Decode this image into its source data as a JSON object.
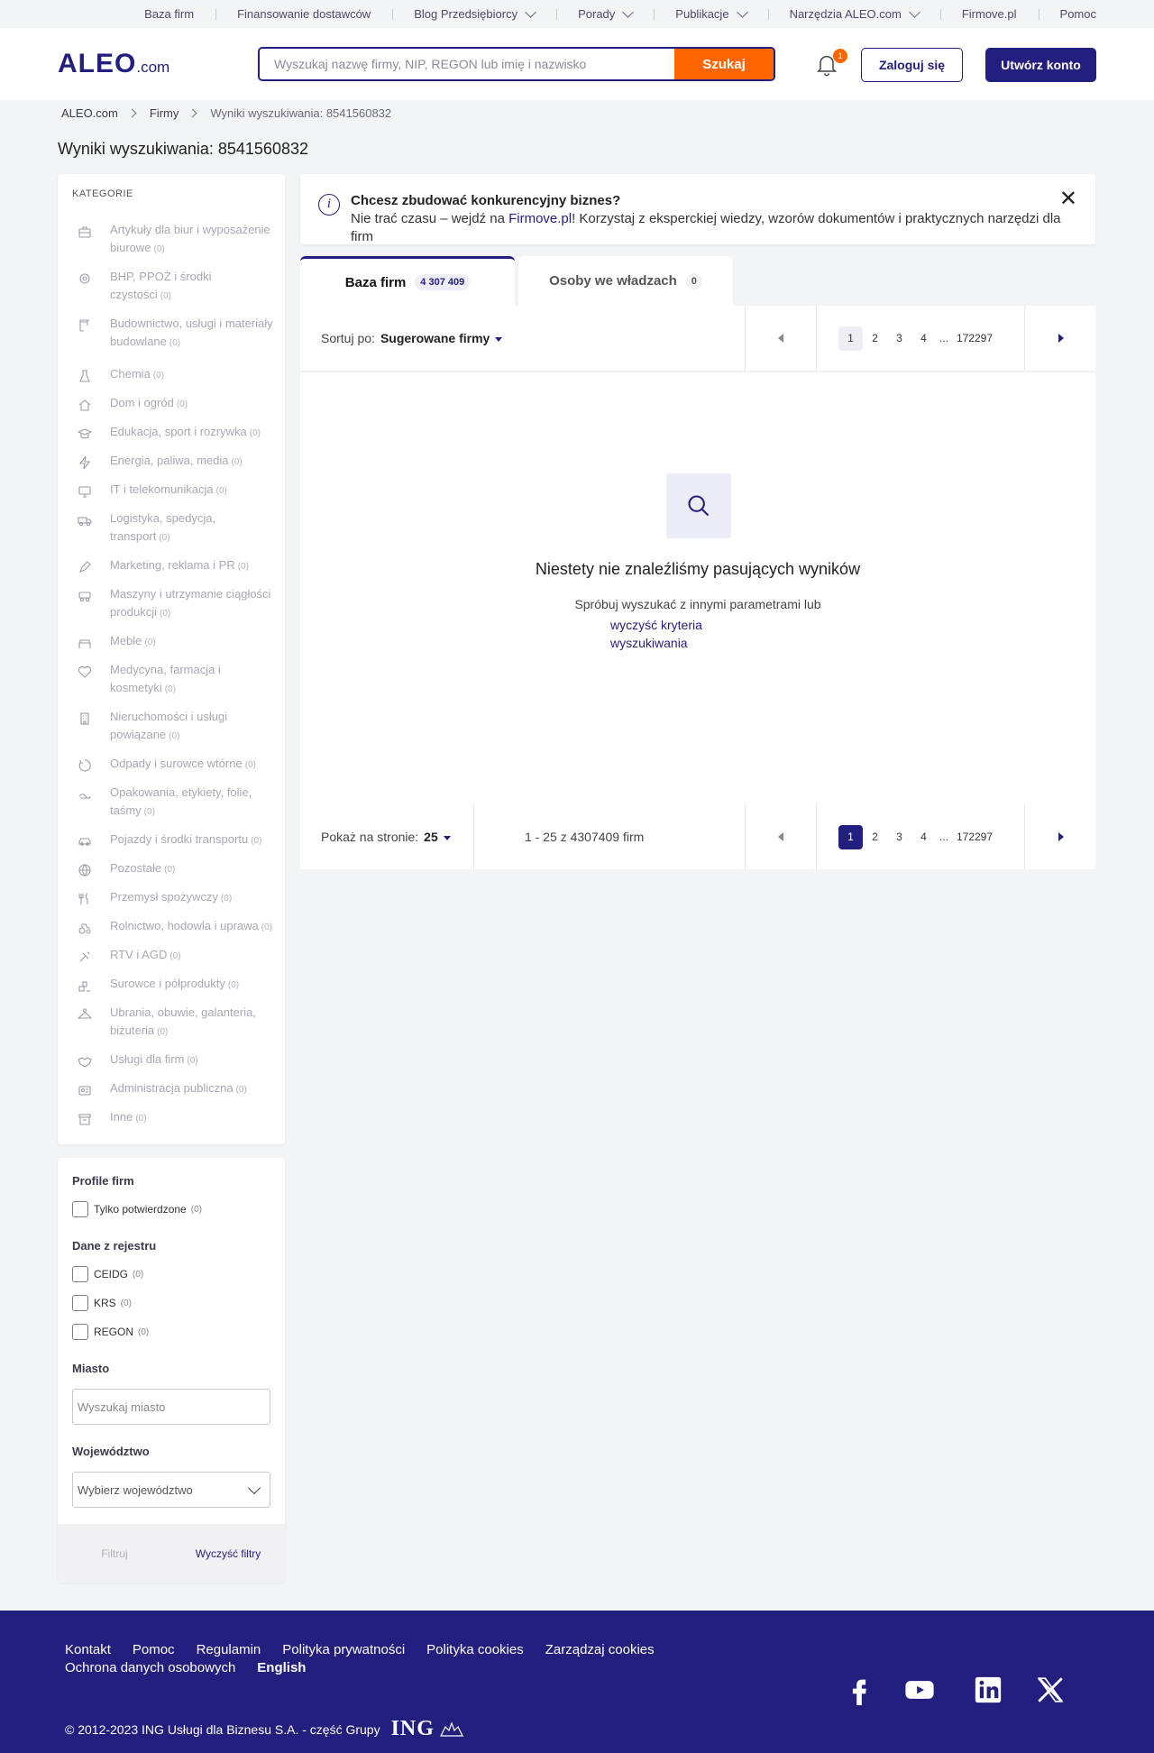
{
  "topnav": {
    "items": [
      "Baza firm",
      "Finansowanie dostawców",
      "Blog Przedsiębiorcy",
      "Porady",
      "Publikacje",
      "Narzędzia ALEO.com",
      "Firmove.pl",
      "Pomoc"
    ]
  },
  "header": {
    "logo_main": "ALEO",
    "logo_suffix": ".com",
    "search_placeholder": "Wyszukaj nazwę firmy, NIP, REGON lub imię i nazwisko",
    "search_button": "Szukaj",
    "notification_count": "1",
    "login_button": "Zaloguj się",
    "create_account_button": "Utwórz konto"
  },
  "breadcrumb": [
    "ALEO.com",
    "Firmy",
    "Wyniki wyszukiwania: 8541560832"
  ],
  "page_title": "Wyniki wyszukiwania: 8541560832",
  "categories": {
    "heading": "KATEGORIE",
    "items": [
      {
        "l1": "Artykuły dla biur i wyposażenie",
        "l2": "biurowe",
        "count": "(0)",
        "icon": "briefcase-icon"
      },
      {
        "l1": "BHP, PPOŻ i środki",
        "l2": "czystości",
        "count": "(0)",
        "icon": "safety-icon"
      },
      {
        "l1": "Budownictwo, usługi i materiały",
        "l2": "budowlane",
        "count": "(0)",
        "icon": "crane-icon"
      },
      {
        "l1": "Chemia",
        "l2": "",
        "count": "(0)",
        "icon": "flask-icon"
      },
      {
        "l1": "Dom i ogród",
        "l2": "",
        "count": "(0)",
        "icon": "house-icon"
      },
      {
        "l1": "Edukacja, sport i rozrywka",
        "l2": "",
        "count": "(0)",
        "icon": "graduation-cap-icon"
      },
      {
        "l1": "Energia, paliwa, media",
        "l2": "",
        "count": "(0)",
        "icon": "lightning-icon"
      },
      {
        "l1": "IT i telekomunikacja",
        "l2": "",
        "count": "(0)",
        "icon": "monitor-icon"
      },
      {
        "l1": "Logistyka, spedycja,",
        "l2": "transport",
        "count": "(0)",
        "icon": "truck-icon"
      },
      {
        "l1": "Marketing, reklama i PR",
        "l2": "",
        "count": "(0)",
        "icon": "pen-icon"
      },
      {
        "l1": "Maszyny i utrzymanie ciągłości",
        "l2": "produkcji",
        "count": "(0)",
        "icon": "machine-icon"
      },
      {
        "l1": "Meble",
        "l2": "",
        "count": "(0)",
        "icon": "sofa-icon"
      },
      {
        "l1": "Medycyna, farmacja i",
        "l2": "kosmetyki",
        "count": "(0)",
        "icon": "heart-icon"
      },
      {
        "l1": "Nieruchomości i usługi",
        "l2": "powiązane",
        "count": "(0)",
        "icon": "building-icon"
      },
      {
        "l1": "Odpady i surowce wtórne",
        "l2": "",
        "count": "(0)",
        "icon": "recycle-icon"
      },
      {
        "l1": "Opakowania, etykiety, folie,",
        "l2": "taśmy",
        "count": "(0)",
        "icon": "package-icon"
      },
      {
        "l1": "Pojazdy i środki transportu",
        "l2": "",
        "count": "(0)",
        "icon": "car-icon"
      },
      {
        "l1": "Pozostałe",
        "l2": "",
        "count": "(0)",
        "icon": "globe-icon"
      },
      {
        "l1": "Przemysł spożywczy",
        "l2": "",
        "count": "(0)",
        "icon": "cutlery-icon"
      },
      {
        "l1": "Rolnictwo, hodowla i uprawa",
        "l2": "",
        "count": "(0)",
        "icon": "tractor-icon"
      },
      {
        "l1": "RTV i AGD",
        "l2": "",
        "count": "(0)",
        "icon": "satellite-icon"
      },
      {
        "l1": "Surowce i półprodukty",
        "l2": "",
        "count": "(0)",
        "icon": "materials-icon"
      },
      {
        "l1": "Ubrania, obuwie, galanteria,",
        "l2": "biżuteria",
        "count": "(0)",
        "icon": "hanger-icon"
      },
      {
        "l1": "Usługi dla firm",
        "l2": "",
        "count": "(0)",
        "icon": "handshake-icon"
      },
      {
        "l1": "Administracja publiczna",
        "l2": "",
        "count": "(0)",
        "icon": "id-card-icon"
      },
      {
        "l1": "Inne",
        "l2": "",
        "count": "(0)",
        "icon": "archive-icon"
      }
    ]
  },
  "filters": {
    "profiles_heading": "Profile firm",
    "confirmed_only": "Tylko potwierdzone",
    "confirmed_count": "(0)",
    "registry_heading": "Dane z rejestru",
    "registry": [
      {
        "label": "CEIDG",
        "count": "(0)"
      },
      {
        "label": "KRS",
        "count": "(0)"
      },
      {
        "label": "REGON",
        "count": "(0)"
      }
    ],
    "city_heading": "Miasto",
    "city_placeholder": "Wyszukaj miasto",
    "voivodeship_heading": "Województwo",
    "voivodeship_placeholder": "Wybierz województwo",
    "filter_button": "Filtruj",
    "clear_button": "Wyczyść filtry"
  },
  "banner": {
    "title": "Chcesz zbudować konkurencyjny biznes?",
    "text_before": "Nie trać czasu – wejdź na ",
    "link": "Firmove.pl",
    "text_after": "! Korzystaj z eksperckiej wiedzy, wzorów dokumentów i praktycznych narzędzi dla firm"
  },
  "tabs": [
    {
      "label": "Baza firm",
      "count": "4 307 409"
    },
    {
      "label": "Osoby we władzach",
      "count": "0"
    }
  ],
  "sort": {
    "label": "Sortuj po:",
    "value": "Sugerowane firmy"
  },
  "pagination": {
    "pages": [
      "1",
      "2",
      "3",
      "4"
    ],
    "ellipsis": "...",
    "last": "172297",
    "current": "1"
  },
  "empty": {
    "heading": "Niestety nie znaleźliśmy pasujących wyników",
    "text": "Spróbuj wyszukać z innymi parametrami lub",
    "link": "wyczyść kryteria wyszukiwania"
  },
  "per_page": {
    "label": "Pokaż na stronie:",
    "value": "25"
  },
  "range_text": "1 - 25 z 4307409 firm",
  "footer": {
    "links": [
      "Kontakt",
      "Pomoc",
      "Regulamin",
      "Polityka prywatności",
      "Polityka cookies",
      "Zarządzaj cookies",
      "Ochrona danych osobowych"
    ],
    "language": "English",
    "copyright": "© 2012-2023 ING Usługi dla Biznesu S.A. - część Grupy",
    "ing": "ING",
    "social": [
      "facebook-icon",
      "youtube-icon",
      "linkedin-icon",
      "x-icon"
    ]
  },
  "colors": {
    "brand": "#231f7f",
    "accent": "#ff6600"
  }
}
